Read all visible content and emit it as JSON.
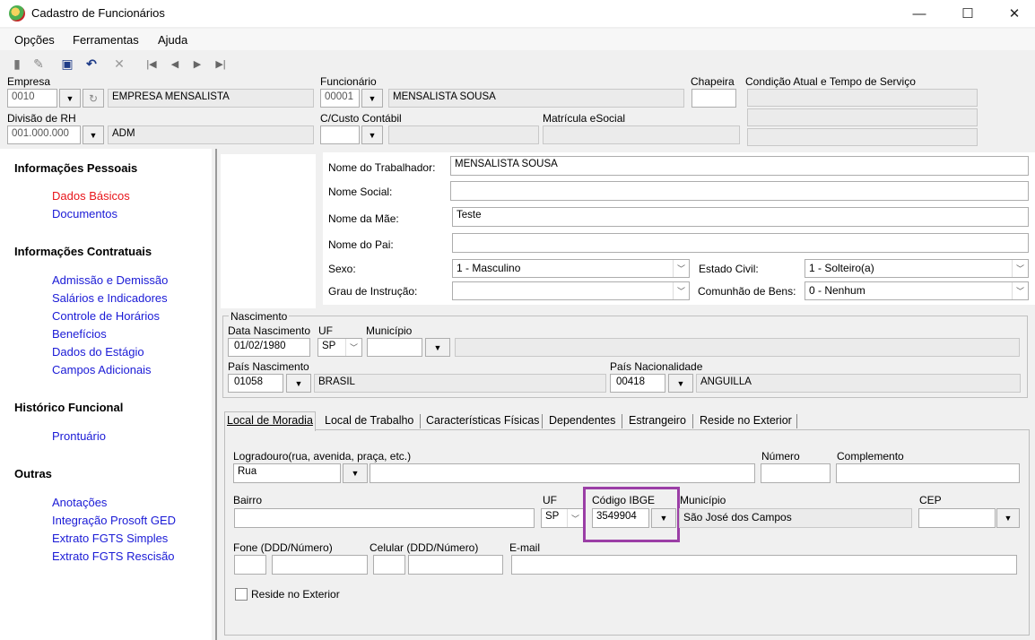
{
  "window": {
    "title": "Cadastro de Funcionários",
    "minimize": "—",
    "maximize": "☐",
    "close": "✕"
  },
  "menu": {
    "opcoes": "Opções",
    "ferramentas": "Ferramentas",
    "ajuda": "Ajuda"
  },
  "header": {
    "empresa_label": "Empresa",
    "empresa_code": "0010",
    "empresa_name": "EMPRESA MENSALISTA",
    "divisao_label": "Divisão de RH",
    "divisao_code": "001.000.000",
    "divisao_name": "ADM",
    "funcionario_label": "Funcionário",
    "funcionario_code": "00001",
    "funcionario_name": "MENSALISTA SOUSA",
    "ccusto_label": "C/Custo Contábil",
    "ccusto_code": "",
    "ccusto_name": "",
    "matricula_label": "Matrícula eSocial",
    "matricula_value": "",
    "chapeira_label": "Chapeira",
    "chapeira_value": "",
    "condicao_label": "Condição Atual e Tempo de Serviço"
  },
  "sidebar": {
    "pessoais": "Informações Pessoais",
    "dados_basicos": "Dados Básicos",
    "documentos": "Documentos",
    "contratuais": "Informações Contratuais",
    "admissao": "Admissão e Demissão",
    "salarios": "Salários e Indicadores",
    "horarios": "Controle de Horários",
    "beneficios": "Benefícios",
    "estagio": "Dados do Estágio",
    "campos": "Campos Adicionais",
    "historico": "Histórico Funcional",
    "prontuario": "Prontuário",
    "outras": "Outras",
    "anotacoes": "Anotações",
    "integracao": "Integração Prosoft GED",
    "fgts_simples": "Extrato FGTS Simples",
    "fgts_rescisao": "Extrato FGTS Rescisão"
  },
  "form": {
    "nome_trab_label": "Nome do Trabalhador:",
    "nome_trab": "MENSALISTA SOUSA",
    "nome_social_label": "Nome Social:",
    "nome_social": "",
    "nome_mae_label": "Nome da Mãe:",
    "nome_mae": "Teste",
    "nome_pai_label": "Nome do Pai:",
    "nome_pai": "",
    "sexo_label": "Sexo:",
    "sexo": "1 - Masculino",
    "estado_civil_label": "Estado Civil:",
    "estado_civil": "1 - Solteiro(a)",
    "grau_label": "Grau de Instrução:",
    "grau": "",
    "comunhao_label": "Comunhão de Bens:",
    "comunhao": "0 - Nenhum"
  },
  "nascimento": {
    "group_label": "Nascimento",
    "data_label": "Data Nascimento",
    "data": "01/02/1980",
    "uf_label": "UF",
    "uf": "SP",
    "municipio_label": "Município",
    "municipio_code": "",
    "municipio_name": "",
    "pais_label": "País Nascimento",
    "pais_code": "01058",
    "pais_name": "BRASIL",
    "nac_label": "País Nacionalidade",
    "nac_code": "00418",
    "nac_name": "ANGUILLA"
  },
  "tabs": [
    "Local de Moradia",
    "Local de Trabalho",
    "Características Físicas",
    "Dependentes",
    "Estrangeiro",
    "Reside no Exterior"
  ],
  "moradia": {
    "logradouro_label": "Logradouro(rua, avenida, praça, etc.)",
    "logradouro_tipo": "Rua",
    "logradouro": "",
    "numero_label": "Número",
    "numero": "",
    "complemento_label": "Complemento",
    "complemento": "",
    "bairro_label": "Bairro",
    "bairro": "",
    "uf_label": "UF",
    "uf": "SP",
    "ibge_label": "Código IBGE",
    "ibge": "3549904",
    "municipio_label": "Município",
    "municipio": "São José dos Campos",
    "cep_label": "CEP",
    "cep": "",
    "fone_label": "Fone (DDD/Número)",
    "celular_label": "Celular (DDD/Número)",
    "email_label": "E-mail",
    "reside_exterior_label": "Reside no Exterior"
  }
}
